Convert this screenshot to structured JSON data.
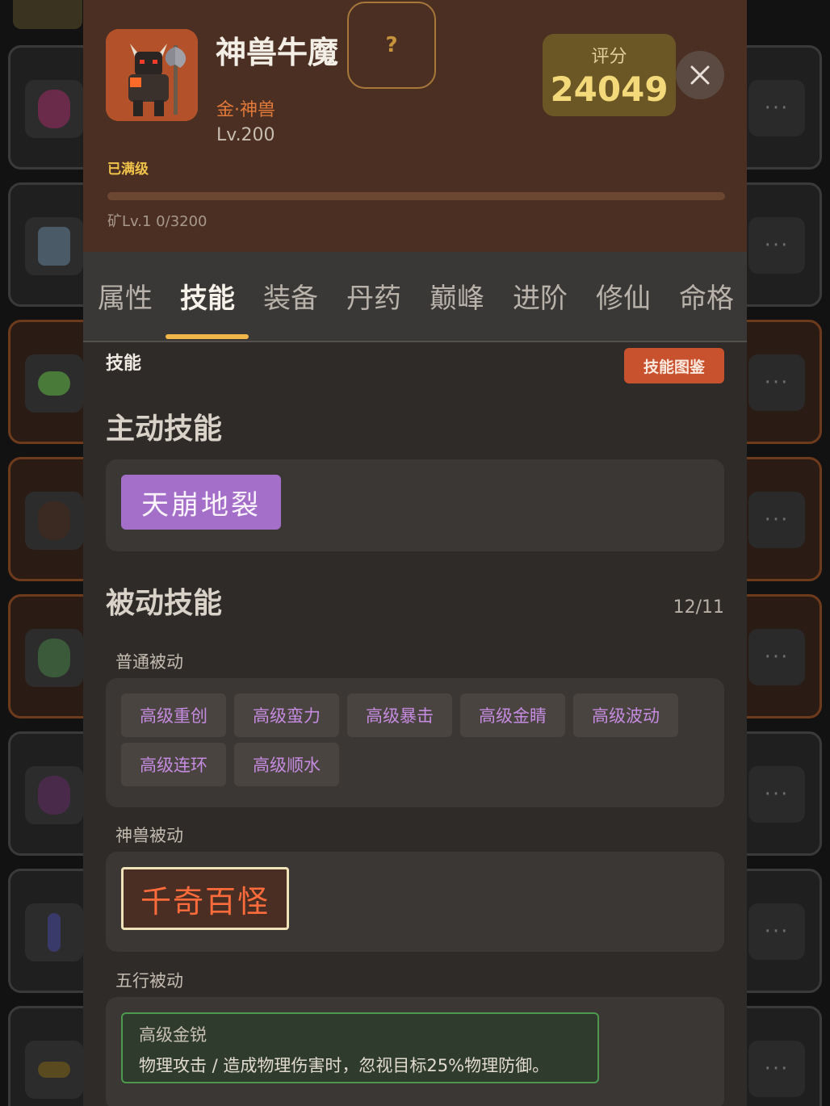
{
  "hero": {
    "name": "神兽牛魔",
    "help": "?",
    "attribute": "金·神兽",
    "level": "Lv.200",
    "maxed": "已满级",
    "mine_progress": "矿Lv.1 0/3200",
    "mine_fraction": 0
  },
  "score": {
    "label": "评分",
    "value": "24049"
  },
  "tabs": [
    "属性",
    "技能",
    "装备",
    "丹药",
    "巅峰",
    "进阶",
    "修仙",
    "命格"
  ],
  "active_tab_index": 1,
  "skills_page": {
    "title": "技能",
    "atlas_button": "技能图鉴",
    "active_title": "主动技能",
    "active_skill": "天崩地裂",
    "passive_title": "被动技能",
    "passive_count": "12/11",
    "normal_label": "普通被动",
    "normal_passives": [
      "高级重创",
      "高级蛮力",
      "高级暴击",
      "高级金睛",
      "高级波动",
      "高级连环",
      "高级顺水"
    ],
    "beast_label": "神兽被动",
    "beast_skill": "千奇百怪",
    "element_label": "五行被动",
    "element_skill_name": "高级金锐",
    "element_skill_desc": "物理攻击 / 造成物理伤害时，忽视目标25%物理防御。"
  },
  "background_list": {
    "more_label": "···"
  },
  "colors": {
    "header_bg": "#4a2f22",
    "accent_orange": "#c9522e",
    "score_gold": "#f3d97a",
    "active_skill_purple": "#a46fc9",
    "passive_text_purple": "#c58be0",
    "beast_red": "#ff6b3a",
    "element_green": "#4d9a4f"
  }
}
